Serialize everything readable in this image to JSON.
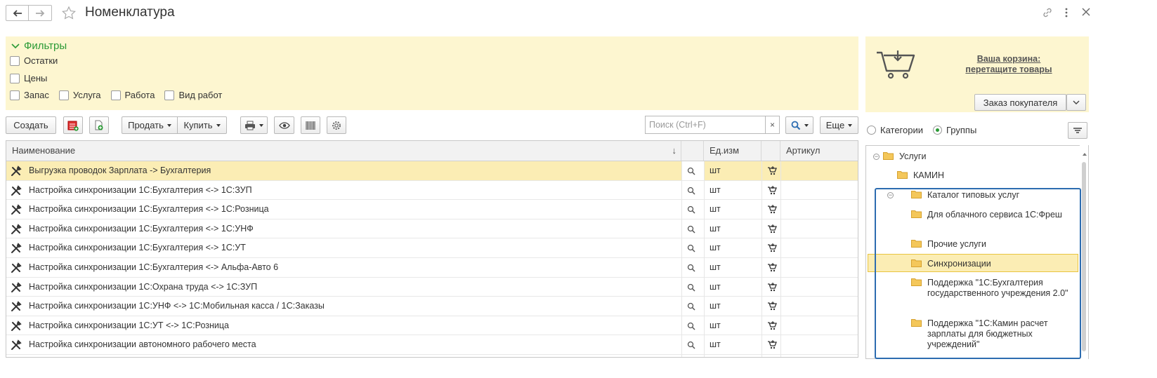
{
  "window": {
    "title": "Номенклатура"
  },
  "filters": {
    "header": "Фильтры",
    "rest_label": "Остатки",
    "prices_label": "Цены",
    "types": [
      "Запас",
      "Услуга",
      "Работа",
      "Вид работ"
    ]
  },
  "cart": {
    "line1": "Ваша корзина:",
    "line2": "перетащите товары",
    "order_button": "Заказ покупателя"
  },
  "toolbar": {
    "create_label": "Создать",
    "sell_label": "Продать",
    "buy_label": "Купить",
    "more_label": "Еще",
    "search_placeholder": "Поиск (Ctrl+F)",
    "clear_label": "×"
  },
  "table": {
    "columns": {
      "name": "Наименование",
      "sort_mark": "↓",
      "unit": "Ед.изм",
      "article": "Артикул"
    },
    "rows": [
      {
        "name": "Выгрузка проводок Зарплата -> Бухгалтерия",
        "unit": "шт",
        "selected": true
      },
      {
        "name": "Настройка синхронизации 1С:Бухгалтерия <-> 1С:ЗУП",
        "unit": "шт"
      },
      {
        "name": "Настройка синхронизации 1С:Бухгалтерия <-> 1С:Розница",
        "unit": "шт"
      },
      {
        "name": "Настройка синхронизации 1С:Бухгалтерия <-> 1С:УНФ",
        "unit": "шт"
      },
      {
        "name": "Настройка синхронизации 1С:Бухгалтерия <-> 1С:УТ",
        "unit": "шт"
      },
      {
        "name": "Настройка синхронизации 1С:Бухгалтерия <-> Альфа-Авто 6",
        "unit": "шт"
      },
      {
        "name": "Настройка синхронизации 1С:Охрана труда <-> 1С:ЗУП",
        "unit": "шт"
      },
      {
        "name": "Настройка синхронизации 1С:УНФ <-> 1С:Мобильная касса / 1С:Заказы",
        "unit": "шт"
      },
      {
        "name": "Настройка синхронизации 1С:УТ <-> 1С:Розница",
        "unit": "шт"
      },
      {
        "name": "Настройка синхронизации автономного рабочего места",
        "unit": "шт"
      }
    ]
  },
  "tree_mode": {
    "categories_label": "Категории",
    "groups_label": "Группы",
    "selected": "Группы"
  },
  "tree": {
    "nodes": [
      {
        "label": "Услуги",
        "level": 0,
        "expanded": true
      },
      {
        "label": "КАМИН",
        "level": 1
      },
      {
        "label": "Каталог типовых услуг",
        "level": 1,
        "expanded": true
      },
      {
        "label": "Для облачного сервиса 1С:Фреш",
        "level": 2
      },
      {
        "label": "Прочие услуги",
        "level": 2
      },
      {
        "label": "Синхронизации",
        "level": 2,
        "selected": true
      },
      {
        "label": "Поддержка \"1С:Бухгалтерия государственного учреждения 2.0\"",
        "level": 2
      },
      {
        "label": "Поддержка \"1С:Камин расчет зарплаты для бюджетных учреждений\"",
        "level": 2
      }
    ]
  },
  "colors": {
    "accent_green": "#2a9a35",
    "filter_bg": "#fdf6d0",
    "selection": "#fbedb4",
    "highlight_box": "#2c6cb0"
  }
}
